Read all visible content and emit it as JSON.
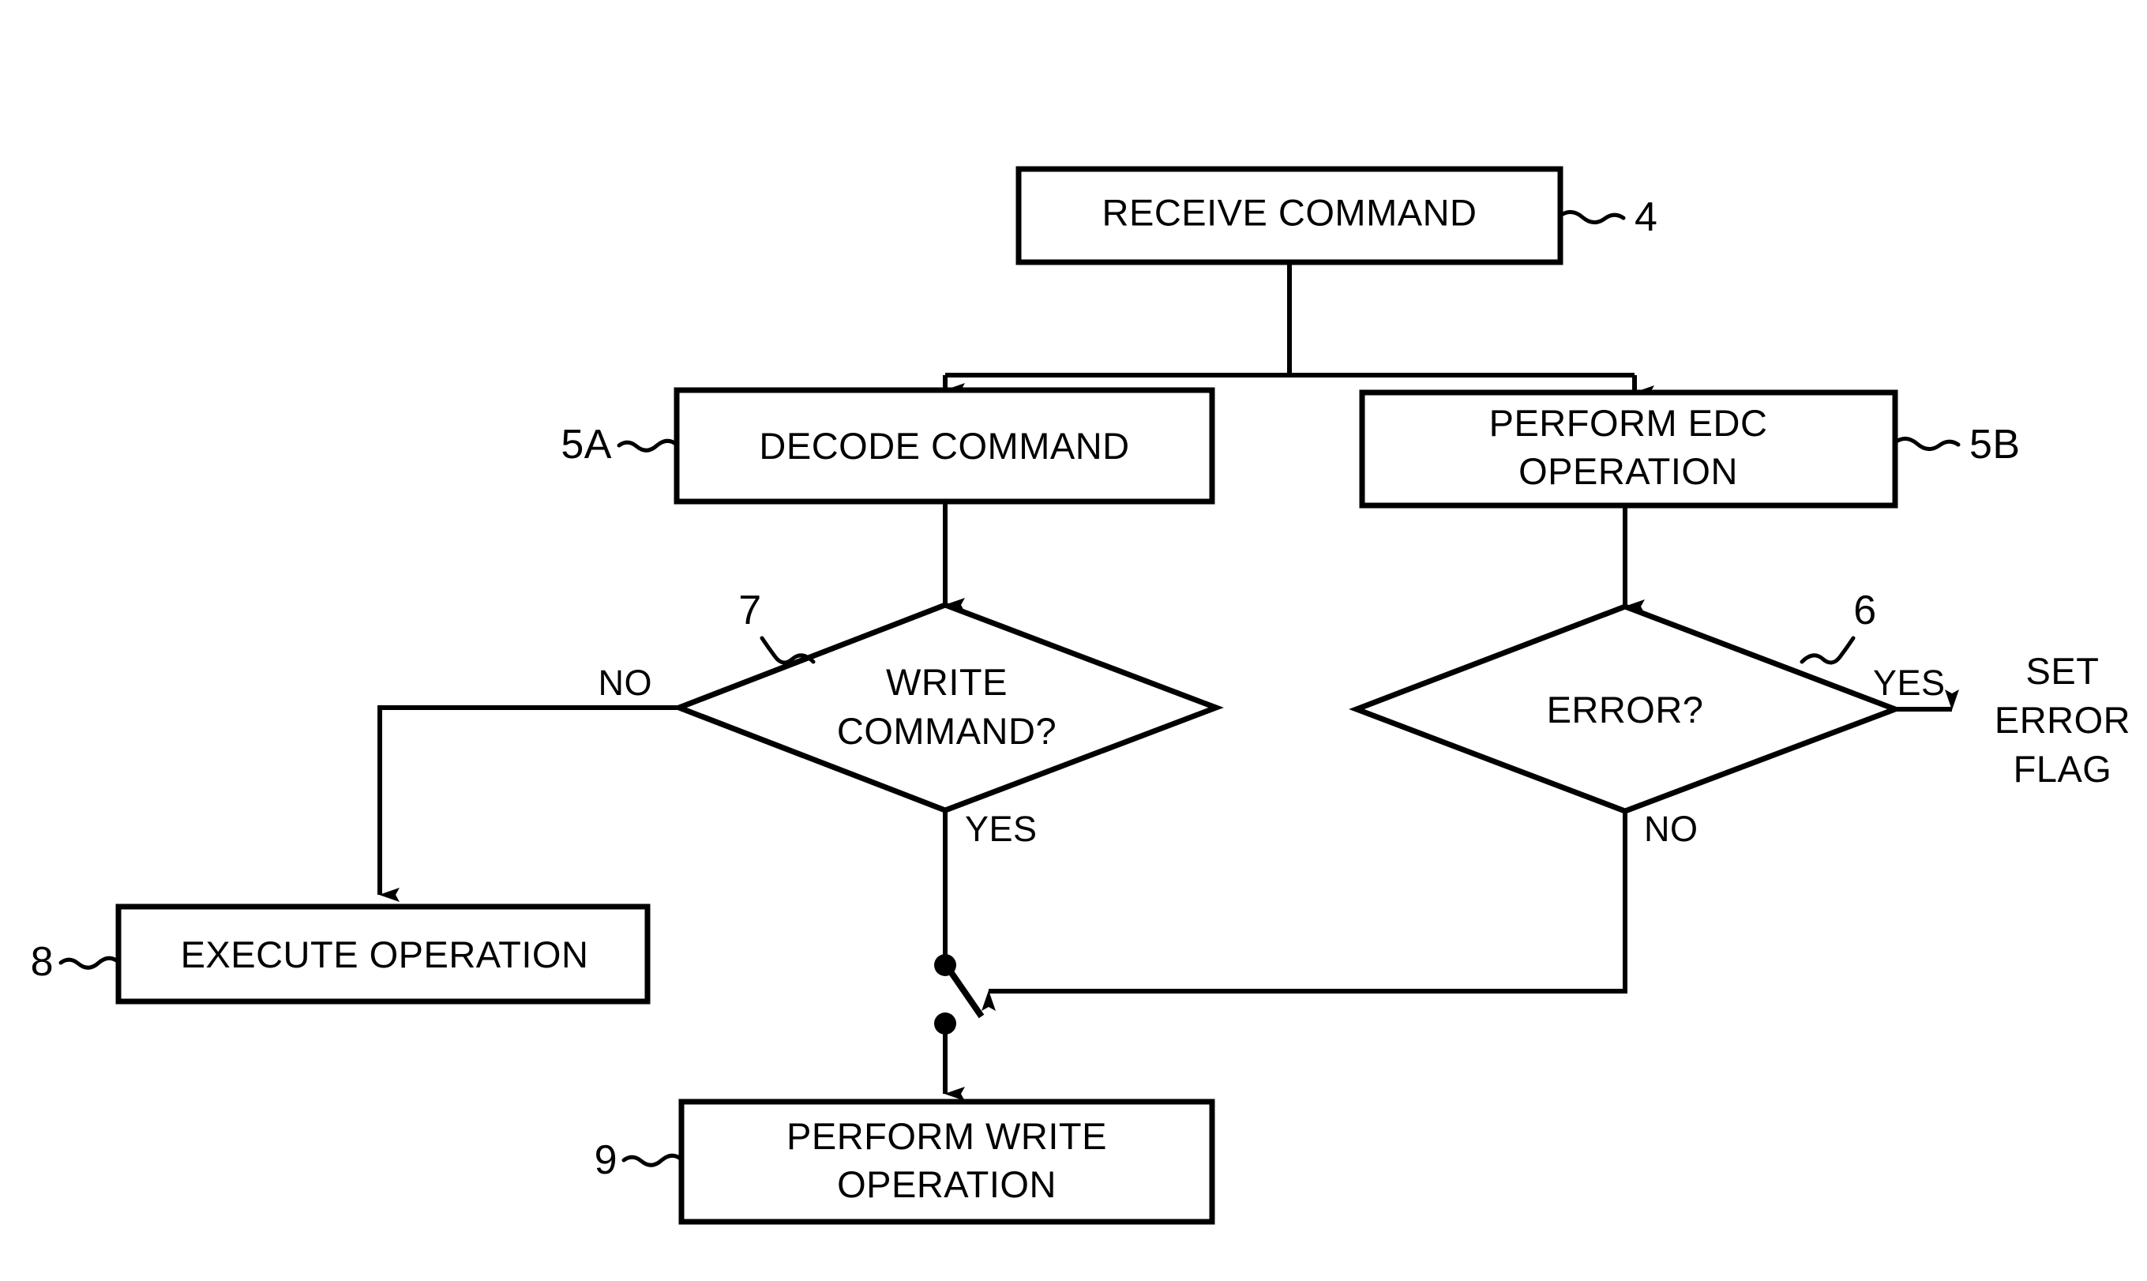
{
  "figure": {
    "type": "flowchart",
    "background_color": "#ffffff",
    "line_color": "#000000"
  },
  "nodes": {
    "receive_command": {
      "label": "RECEIVE COMMAND",
      "ref": "4",
      "shape": "process"
    },
    "decode_command": {
      "label": "DECODE COMMAND",
      "ref": "5A",
      "shape": "process"
    },
    "perform_edc": {
      "label_line1": "PERFORM EDC",
      "label_line2": "OPERATION",
      "ref": "5B",
      "shape": "process"
    },
    "write_command": {
      "label_line1": "WRITE",
      "label_line2": "COMMAND?",
      "ref": "7",
      "shape": "decision"
    },
    "error": {
      "label": "ERROR?",
      "ref": "6",
      "shape": "decision"
    },
    "execute_operation": {
      "label": "EXECUTE OPERATION",
      "ref": "8",
      "shape": "process"
    },
    "perform_write": {
      "label_line1": "PERFORM WRITE",
      "label_line2": "OPERATION",
      "ref": "9",
      "shape": "process"
    },
    "set_error_flag": {
      "label_line1": "SET",
      "label_line2": "ERROR",
      "label_line3": "FLAG",
      "shape": "terminal-text"
    }
  },
  "edge_labels": {
    "write_command_no": "NO",
    "write_command_yes": "YES",
    "error_yes": "YES",
    "error_no": "NO"
  }
}
